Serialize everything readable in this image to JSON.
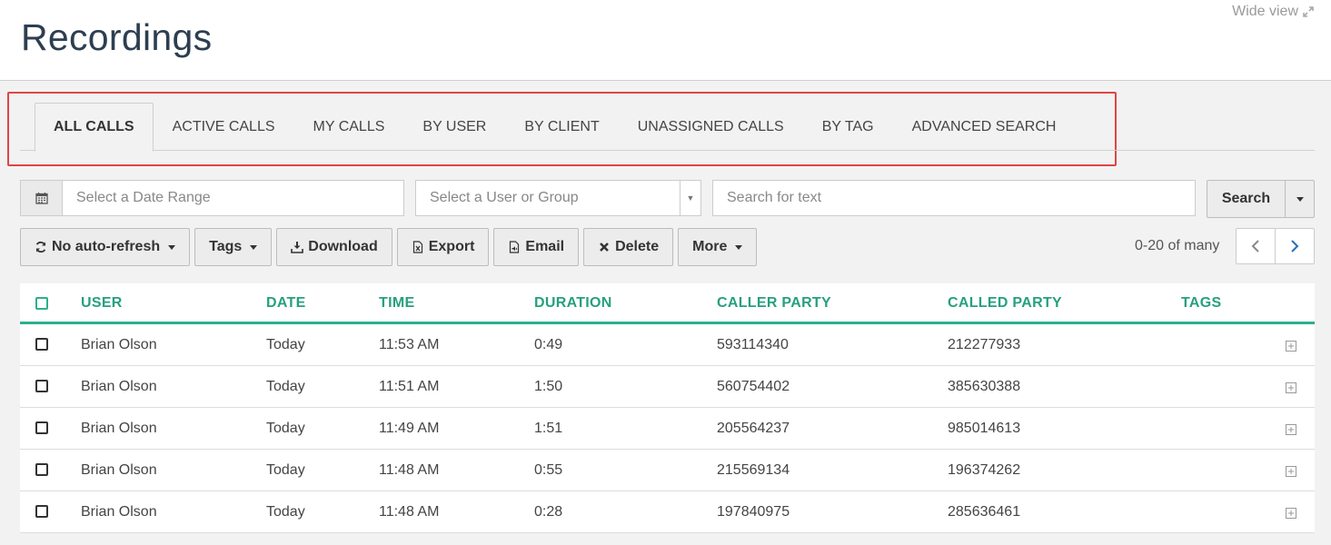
{
  "header": {
    "title": "Recordings",
    "wide_view": "Wide view"
  },
  "tabs": [
    {
      "label": "ALL CALLS",
      "active": true
    },
    {
      "label": "ACTIVE CALLS"
    },
    {
      "label": "MY CALLS"
    },
    {
      "label": "BY USER"
    },
    {
      "label": "BY CLIENT"
    },
    {
      "label": "UNASSIGNED CALLS"
    },
    {
      "label": "BY TAG"
    },
    {
      "label": "ADVANCED SEARCH"
    }
  ],
  "filters": {
    "date_placeholder": "Select a Date Range",
    "user_placeholder": "Select a User or Group",
    "text_placeholder": "Search for text",
    "search_label": "Search"
  },
  "toolbar": {
    "refresh_label": "No auto-refresh",
    "tags_label": "Tags",
    "download_label": "Download",
    "export_label": "Export",
    "email_label": "Email",
    "delete_label": "Delete",
    "more_label": "More"
  },
  "pager": {
    "text": "0-20 of many"
  },
  "table": {
    "columns": [
      "USER",
      "DATE",
      "TIME",
      "DURATION",
      "CALLER PARTY",
      "CALLED PARTY",
      "TAGS"
    ],
    "rows": [
      {
        "user": "Brian Olson",
        "date": "Today",
        "time": "11:53 AM",
        "duration": "0:49",
        "caller": "593114340",
        "called": "212277933"
      },
      {
        "user": "Brian Olson",
        "date": "Today",
        "time": "11:51 AM",
        "duration": "1:50",
        "caller": "560754402",
        "called": "385630388"
      },
      {
        "user": "Brian Olson",
        "date": "Today",
        "time": "11:49 AM",
        "duration": "1:51",
        "caller": "205564237",
        "called": "985014613"
      },
      {
        "user": "Brian Olson",
        "date": "Today",
        "time": "11:48 AM",
        "duration": "0:55",
        "caller": "215569134",
        "called": "196374262"
      },
      {
        "user": "Brian Olson",
        "date": "Today",
        "time": "11:48 AM",
        "duration": "0:28",
        "caller": "197840975",
        "called": "285636461"
      }
    ]
  },
  "colors": {
    "accent_green": "#26a07f",
    "title": "#2d3e50",
    "highlight_red": "#e04545"
  }
}
